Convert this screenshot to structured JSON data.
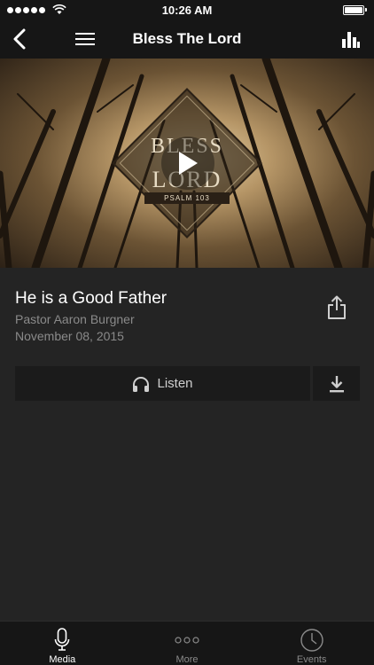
{
  "status_bar": {
    "time": "10:26 AM",
    "signal_dots": 5
  },
  "nav": {
    "title": "Bless The Lord",
    "back_icon": "back-chevron-icon",
    "menu_icon": "hamburger-menu-icon",
    "stats_icon": "bar-chart-icon"
  },
  "hero": {
    "emblem_line1": "BLESS",
    "emblem_line2": "LORD",
    "emblem_banner": "PSALM 103",
    "play_icon": "play-icon"
  },
  "sermon": {
    "title": "He is a Good Father",
    "speaker": "Pastor Aaron Burgner",
    "date": "November 08, 2015",
    "share_icon": "share-icon"
  },
  "actions": {
    "listen_label": "Listen",
    "listen_icon": "headphones-icon",
    "download_icon": "download-icon"
  },
  "tabs": [
    {
      "label": "Media",
      "icon": "microphone-icon",
      "active": true
    },
    {
      "label": "More",
      "icon": "more-dots-icon",
      "active": false
    },
    {
      "label": "Events",
      "icon": "clock-icon",
      "active": false
    }
  ],
  "colors": {
    "background": "#242424",
    "bar": "#161616",
    "button": "#1b1b1b",
    "secondary_text": "#8a8a8a"
  }
}
